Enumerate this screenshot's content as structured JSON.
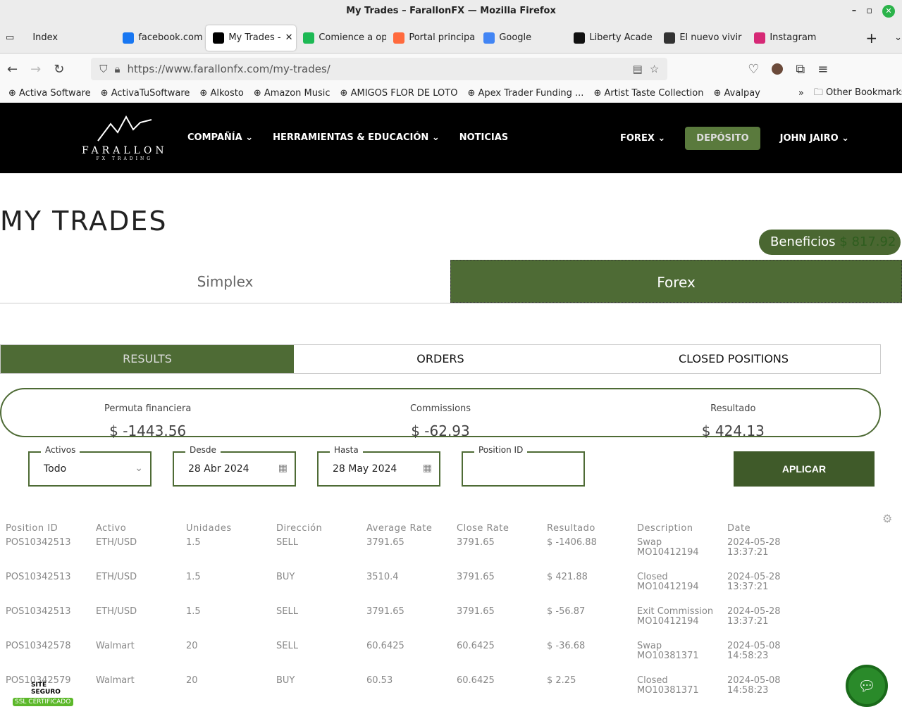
{
  "window": {
    "title": "My Trades – FarallonFX — Mozilla Firefox"
  },
  "tabs": [
    {
      "label": "Index",
      "color": "#ececec"
    },
    {
      "label": "facebook.com",
      "color": "#1877f2"
    },
    {
      "label": "My Trades -",
      "color": "#000000"
    },
    {
      "label": "Comience a op",
      "color": "#1db954"
    },
    {
      "label": "Portal principa",
      "color": "#ff6a3d"
    },
    {
      "label": "Google",
      "color": "#4285f4"
    },
    {
      "label": "Liberty Acade",
      "color": "#111111"
    },
    {
      "label": "El nuevo vivir",
      "color": "#333333"
    },
    {
      "label": "Instagram",
      "color": "#d62976"
    }
  ],
  "url": "https://www.farallonfx.com/my-trades/",
  "bookmarks": [
    "Activa Software",
    "ActivaTuSoftware",
    "Alkosto",
    "Amazon Music",
    "AMIGOS FLOR DE LOTO",
    "Apex Trader Funding ...",
    "Artist Taste Collection",
    "Avalpay"
  ],
  "other_bookmarks": "Other Bookmarks",
  "site": {
    "logo": "FARALLON",
    "logo_sub": "FX TRADING",
    "menu": [
      "COMPAÑÍA",
      "HERRAMIENTAS & EDUCACIÓN",
      "NOTICIAS"
    ],
    "forex": "FOREX",
    "deposit": "DEPÓSITO",
    "user": "JOHN JAIRO"
  },
  "page_title": "MY TRADES",
  "beneficios": {
    "label": "Beneficios",
    "value": "$ 817.92"
  },
  "main_tabs": [
    "Simplex",
    "Forex"
  ],
  "sub_tabs": [
    "RESULTS",
    "ORDERS",
    "CLOSED POSITIONS"
  ],
  "summary": [
    {
      "label": "Permuta financiera",
      "value": "$ -1443.56"
    },
    {
      "label": "Commissions",
      "value": "$ -62.93"
    },
    {
      "label": "Resultado",
      "value": "$ 424.13"
    }
  ],
  "filters": {
    "activos": {
      "label": "Activos",
      "value": "Todo"
    },
    "desde": {
      "label": "Desde",
      "value": "28 Abr 2024"
    },
    "hasta": {
      "label": "Hasta",
      "value": "28 May 2024"
    },
    "position": {
      "label": "Position ID",
      "value": ""
    },
    "apply": "APLICAR"
  },
  "table": {
    "headers": [
      "Position ID",
      "Activo",
      "Unidades",
      "Dirección",
      "Average Rate",
      "Close Rate",
      "Resultado",
      "Description",
      "Date"
    ],
    "rows": [
      [
        "POS10342513",
        "ETH/USD",
        "1.5",
        "SELL",
        "3791.65",
        "3791.65",
        "$ -1406.88",
        "Swap",
        "MO10412194",
        "2024-05-28",
        "13:37:21"
      ],
      [
        "POS10342513",
        "ETH/USD",
        "1.5",
        "BUY",
        "3510.4",
        "3791.65",
        "$ 421.88",
        "Closed",
        "MO10412194",
        "2024-05-28",
        "13:37:21"
      ],
      [
        "POS10342513",
        "ETH/USD",
        "1.5",
        "SELL",
        "3791.65",
        "3791.65",
        "$ -56.87",
        "Exit Commission",
        "MO10412194",
        "2024-05-28",
        "13:37:21"
      ],
      [
        "POS10342578",
        "Walmart",
        "20",
        "SELL",
        "60.6425",
        "60.6425",
        "$ -36.68",
        "Swap",
        "MO10381371",
        "2024-05-08",
        "14:58:23"
      ],
      [
        "POS10342579",
        "Walmart",
        "20",
        "BUY",
        "60.53",
        "60.6425",
        "$ 2.25",
        "Closed",
        "MO10381371",
        "2024-05-08",
        "14:58:23"
      ]
    ]
  },
  "ssl": {
    "top": "SITE SEGURO",
    "bottom": "SSL CERTIFICADO"
  }
}
